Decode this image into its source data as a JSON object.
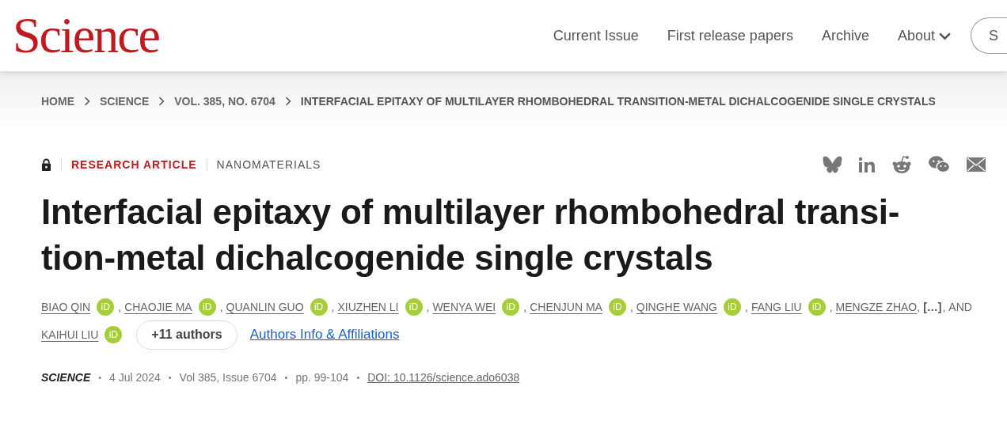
{
  "logo": "Science",
  "nav": [
    {
      "label": "Current Issue",
      "dropdown": false
    },
    {
      "label": "First release papers",
      "dropdown": false
    },
    {
      "label": "Archive",
      "dropdown": false
    },
    {
      "label": "About",
      "dropdown": true
    }
  ],
  "header_button": "S",
  "breadcrumb": [
    "HOME",
    "SCIENCE",
    "VOL. 385, NO. 6704",
    "INTERFACIAL EPITAXY OF MULTILAYER RHOMBOHEDRAL TRANSITION-METAL DICHALCOGENIDE SINGLE CRYSTALS"
  ],
  "access": {
    "locked": true
  },
  "article_type": "RESEARCH ARTICLE",
  "subject": "NANOMATERIALS",
  "share": [
    {
      "kind": "bluesky"
    },
    {
      "kind": "linkedin"
    },
    {
      "kind": "reddit"
    },
    {
      "kind": "wechat"
    },
    {
      "kind": "email"
    }
  ],
  "title_lines": [
    "Interfacial epitaxy of multilayer rhombohedral transi-",
    "tion-metal dichalcogenide single crystals"
  ],
  "authors": [
    {
      "name": "BIAO QIN",
      "orcid": "iD",
      "after": ","
    },
    {
      "name": "CHAOJIE MA",
      "orcid": "iD",
      "after": ","
    },
    {
      "name": "QUANLIN GUO",
      "orcid": "iD",
      "after": ","
    },
    {
      "name": "XIUZHEN LI",
      "orcid": "iD",
      "after": ","
    },
    {
      "name": "WENYA WEI",
      "orcid": "iD",
      "after": ","
    },
    {
      "name": "CHENJUN MA",
      "orcid": "iD",
      "after": ","
    },
    {
      "name": "QINGHE WANG",
      "orcid": "iD",
      "after": ","
    },
    {
      "name": "FANG LIU",
      "orcid": "iD",
      "after": ","
    },
    {
      "name": "MENGZE ZHAO",
      "after": ","
    }
  ],
  "ellipsis": {
    "text": "[…]",
    "after": ","
  },
  "conjunction": "AND",
  "last_author": {
    "name": "KAIHUI LIU",
    "orcid": "iD"
  },
  "more_authors": "+11 authors",
  "affiliations_link": "Authors Info & Affiliations",
  "meta": [
    {
      "kind": "journal",
      "text": "SCIENCE"
    },
    {
      "kind": "plain",
      "bullet": "•",
      "text": "4 Jul 2024"
    },
    {
      "kind": "plain",
      "bullet": "•",
      "text": "Vol 385, Issue 6704"
    },
    {
      "kind": "plain",
      "bullet": "•",
      "text": "pp. 99-104"
    },
    {
      "kind": "link",
      "bullet": "•",
      "text": "DOI: 10.1126/science.ado6038"
    }
  ]
}
